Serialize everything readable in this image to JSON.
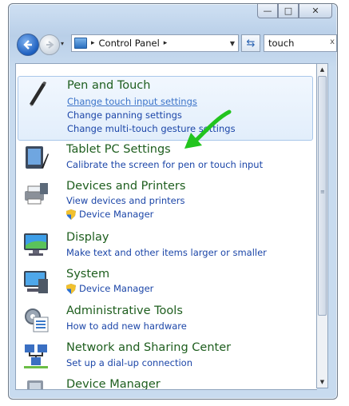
{
  "window": {
    "caption_buttons": [
      {
        "name": "minimize",
        "glyph": "—"
      },
      {
        "name": "maximize",
        "glyph": "□"
      },
      {
        "name": "close",
        "glyph": "✕"
      }
    ]
  },
  "toolbar": {
    "history_glyph": "▾",
    "breadcrumb": "Control Panel",
    "separator_glyph": "▸",
    "dropdown_glyph": "▼",
    "refresh_glyph": "⇆",
    "search_value": "touch",
    "search_clear_glyph": "x"
  },
  "results": [
    {
      "title": "Pen and Touch",
      "links": [
        "Change touch input settings",
        "Change panning settings",
        "Change multi-touch gesture settings"
      ]
    },
    {
      "title": "Tablet PC Settings",
      "links": [
        "Calibrate the screen for pen or touch input"
      ]
    },
    {
      "title": "Devices and Printers",
      "links": [
        "View devices and printers"
      ],
      "shield_link": "Device Manager"
    },
    {
      "title": "Display",
      "links": [
        "Make text and other items larger or smaller"
      ]
    },
    {
      "title": "System",
      "links": [],
      "shield_link": "Device Manager"
    },
    {
      "title": "Administrative Tools",
      "links": [
        "How to add new hardware"
      ]
    },
    {
      "title": "Network and Sharing Center",
      "links": [
        "Set up a dial-up connection"
      ]
    },
    {
      "title": "Device Manager",
      "links": []
    }
  ],
  "scrollbar": {
    "up_glyph": "▲",
    "down_glyph": "▼",
    "grip_glyph": "≡"
  },
  "colors": {
    "arrow": "#22c41e",
    "title_green": "#1e5e1e",
    "link_blue": "#1c46a8"
  }
}
